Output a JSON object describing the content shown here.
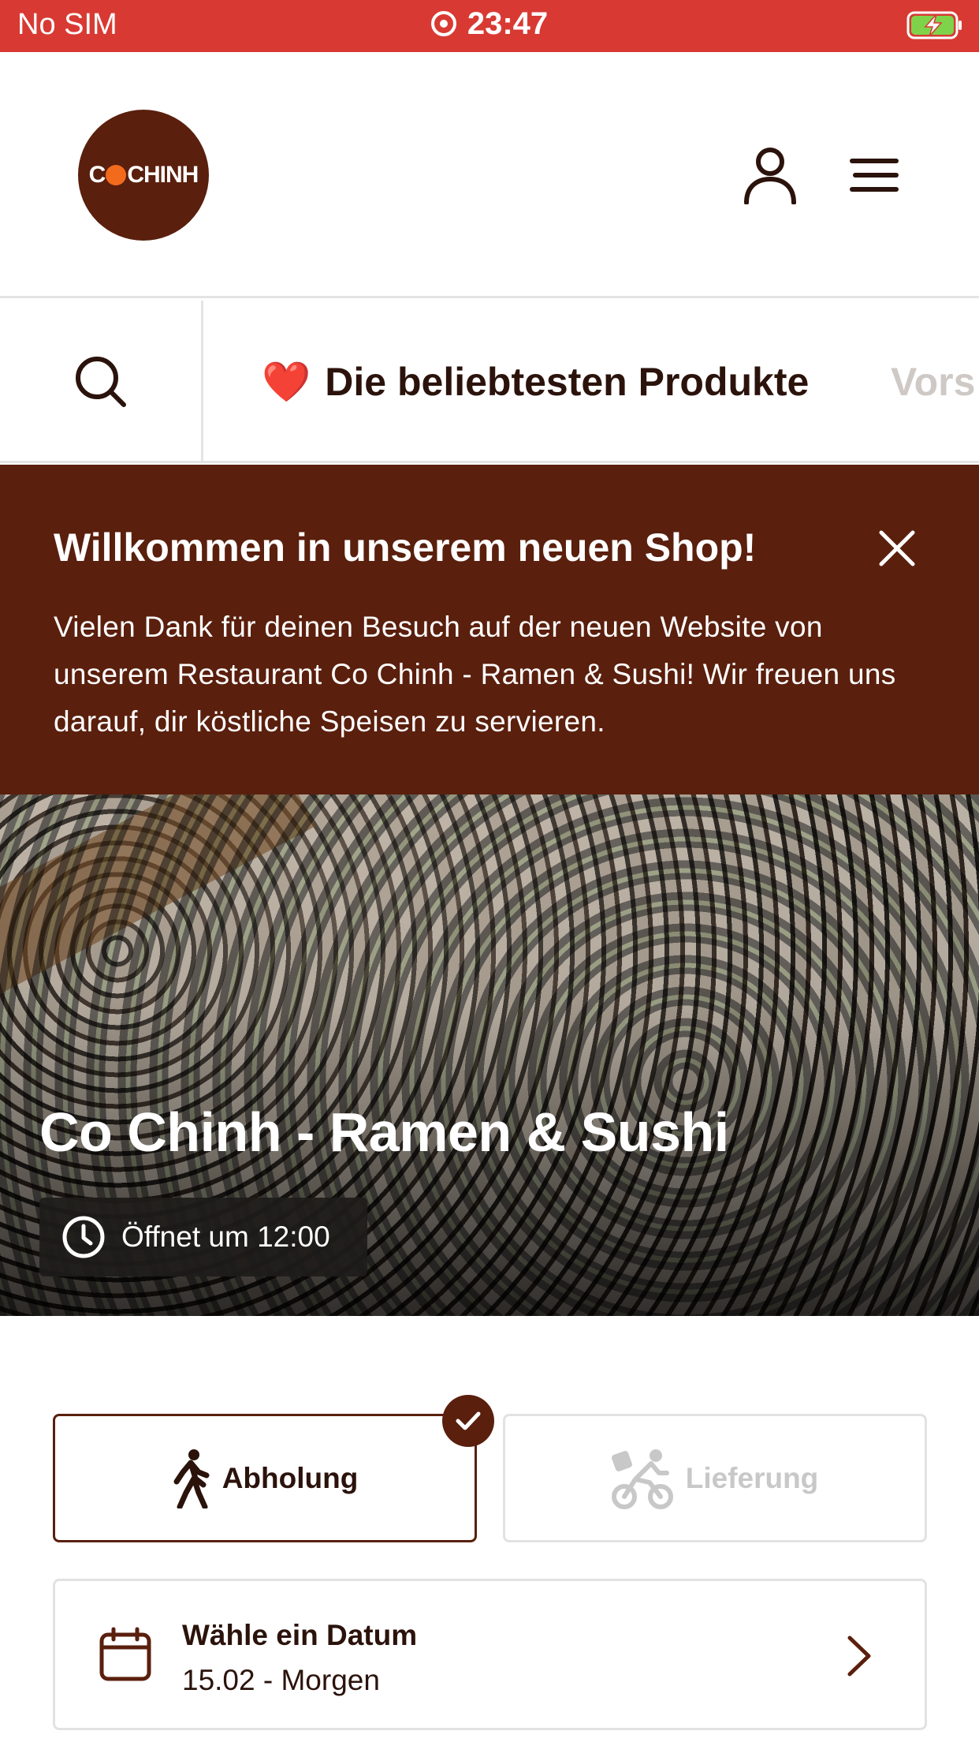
{
  "status_bar": {
    "carrier": "No SIM",
    "time": "23:47",
    "battery_color": "#7ed34a"
  },
  "header": {
    "logo_text_before": "C",
    "logo_text_after": "CHINH",
    "icons": [
      "user-icon",
      "menu-icon"
    ]
  },
  "category_nav": {
    "search_icon": "search-icon",
    "active_tab": {
      "emoji": "❤️",
      "label": "Die beliebtesten Produkte"
    },
    "next_tab_label": "Vors"
  },
  "welcome": {
    "title": "Willkommen in unserem neuen Shop!",
    "body": "Vielen Dank für deinen Besuch auf der neuen Website von unserem Restaurant Co Chinh - Ramen & Sushi! Wir freuen uns darauf, dir köstliche Speisen zu servieren.",
    "close_icon": "close-icon"
  },
  "hero": {
    "restaurant_name": "Co Chinh - Ramen & Sushi",
    "hours_text": "Öffnet um 12:00"
  },
  "order_mode": {
    "pickup_label": "Abholung",
    "delivery_label": "Lieferung",
    "selected": "pickup"
  },
  "date_picker": {
    "label": "Wähle ein Datum",
    "value": "15.02 - Morgen"
  },
  "colors": {
    "brand": "#5a1f0d",
    "status_bar": "#d83a33",
    "accent_orange": "#f26b1d"
  }
}
